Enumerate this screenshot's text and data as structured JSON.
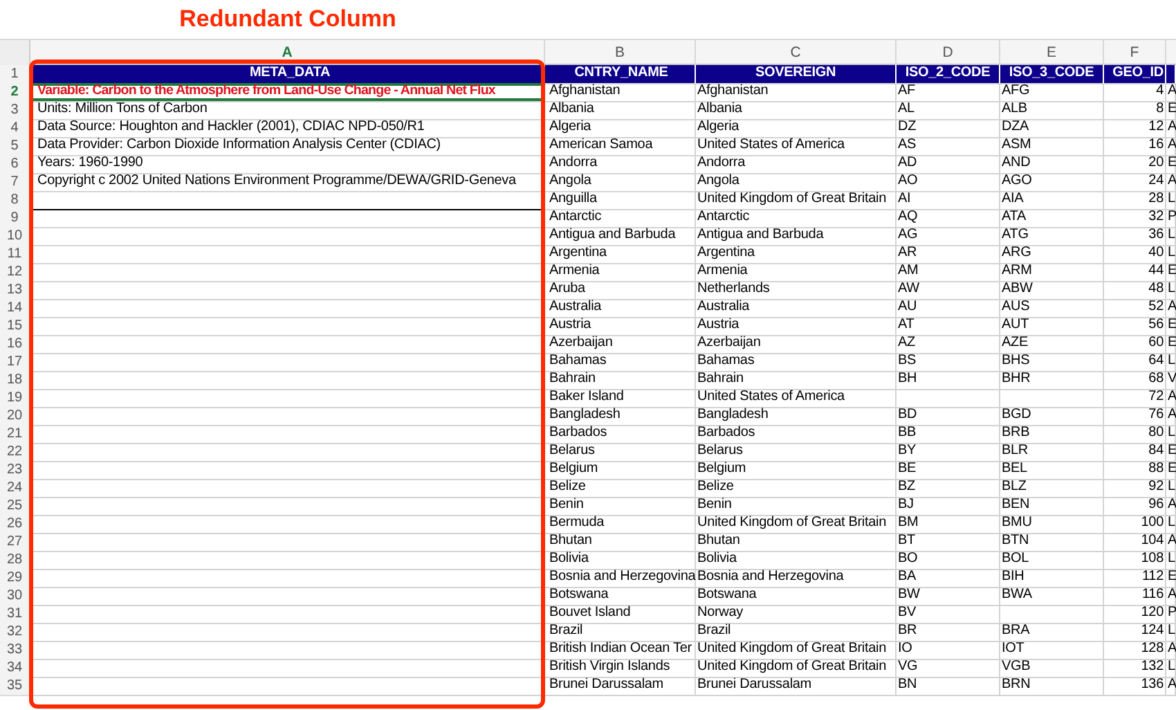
{
  "annotation": {
    "title": "Redundant Column"
  },
  "columns": [
    {
      "letter": "A",
      "selected": true
    },
    {
      "letter": "B",
      "selected": false
    },
    {
      "letter": "C",
      "selected": false
    },
    {
      "letter": "D",
      "selected": false
    },
    {
      "letter": "E",
      "selected": false
    },
    {
      "letter": "F",
      "selected": false
    }
  ],
  "rows": [
    {
      "number": "1",
      "kind": "header",
      "selected": false,
      "A": "META_DATA",
      "B": "CNTRY_NAME",
      "C": "SOVEREIGN",
      "D": "ISO_2_CODE",
      "E": "ISO_3_CODE",
      "F": "GEO_ID"
    },
    {
      "number": "2",
      "kind": "highlight",
      "selected": true,
      "A": "Variable: Carbon to the Atmosphere from Land-Use Change - Annual Net Flux",
      "B": "Afghanistan",
      "C": "Afghanistan",
      "D": "AF",
      "E": "AFG",
      "F": "4",
      "column_7": "A"
    },
    {
      "number": "3",
      "kind": "data",
      "selected": false,
      "A": "Units: Million Tons of Carbon",
      "B": "Albania",
      "C": "Albania",
      "D": "AL",
      "E": "ALB",
      "F": "8",
      "column_7": "E"
    },
    {
      "number": "4",
      "kind": "data",
      "selected": false,
      "A": "Data Source: Houghton and Hackler (2001), CDIAC NPD-050/R1",
      "B": "Algeria",
      "C": "Algeria",
      "D": "DZ",
      "E": "DZA",
      "F": "12",
      "column_7": "A"
    },
    {
      "number": "5",
      "kind": "data",
      "selected": false,
      "A": "Data Provider: Carbon Dioxide Information Analysis Center (CDIAC)",
      "B": "American Samoa",
      "C": "United States of America",
      "D": "AS",
      "E": "ASM",
      "F": "16",
      "column_7": "A"
    },
    {
      "number": "6",
      "kind": "data",
      "selected": false,
      "A": "Years: 1960-1990",
      "B": "Andorra",
      "C": "Andorra",
      "D": "AD",
      "E": "AND",
      "F": "20",
      "column_7": "E"
    },
    {
      "number": "7",
      "kind": "data",
      "selected": false,
      "A": "Copyright c 2002 United Nations Environment Programme/DEWA/GRID-Geneva",
      "B": "Angola",
      "C": "Angola",
      "D": "AO",
      "E": "AGO",
      "F": "24",
      "column_7": "A"
    },
    {
      "number": "8",
      "kind": "divider",
      "selected": false,
      "B": "Anguilla",
      "C": "United Kingdom of Great Britain",
      "D": "AI",
      "E": "AIA",
      "F": "28",
      "column_7": "L"
    },
    {
      "number": "9",
      "kind": "data",
      "selected": false,
      "B": "Antarctic",
      "C": "Antarctic",
      "D": "AQ",
      "E": "ATA",
      "F": "32",
      "column_7": "P"
    },
    {
      "number": "10",
      "kind": "data",
      "selected": false,
      "B": "Antigua and Barbuda",
      "C": "Antigua and Barbuda",
      "D": "AG",
      "E": "ATG",
      "F": "36",
      "column_7": "L"
    },
    {
      "number": "11",
      "kind": "data",
      "selected": false,
      "B": "Argentina",
      "C": "Argentina",
      "D": "AR",
      "E": "ARG",
      "F": "40",
      "column_7": "L"
    },
    {
      "number": "12",
      "kind": "data",
      "selected": false,
      "B": "Armenia",
      "C": "Armenia",
      "D": "AM",
      "E": "ARM",
      "F": "44",
      "column_7": "E"
    },
    {
      "number": "13",
      "kind": "data",
      "selected": false,
      "B": "Aruba",
      "C": "Netherlands",
      "D": "AW",
      "E": "ABW",
      "F": "48",
      "column_7": "L"
    },
    {
      "number": "14",
      "kind": "data",
      "selected": false,
      "B": "Australia",
      "C": "Australia",
      "D": "AU",
      "E": "AUS",
      "F": "52",
      "column_7": "A"
    },
    {
      "number": "15",
      "kind": "data",
      "selected": false,
      "B": "Austria",
      "C": "Austria",
      "D": "AT",
      "E": "AUT",
      "F": "56",
      "column_7": "E"
    },
    {
      "number": "16",
      "kind": "data",
      "selected": false,
      "B": "Azerbaijan",
      "C": "Azerbaijan",
      "D": "AZ",
      "E": "AZE",
      "F": "60",
      "column_7": "E"
    },
    {
      "number": "17",
      "kind": "data",
      "selected": false,
      "B": "Bahamas",
      "C": "Bahamas",
      "D": "BS",
      "E": "BHS",
      "F": "64",
      "column_7": "L"
    },
    {
      "number": "18",
      "kind": "data",
      "selected": false,
      "B": "Bahrain",
      "C": "Bahrain",
      "D": "BH",
      "E": "BHR",
      "F": "68",
      "column_7": "V"
    },
    {
      "number": "19",
      "kind": "data",
      "selected": false,
      "B": "Baker Island",
      "C": "United States of America",
      "F": "72",
      "column_7": "A"
    },
    {
      "number": "20",
      "kind": "data",
      "selected": false,
      "B": "Bangladesh",
      "C": "Bangladesh",
      "D": "BD",
      "E": "BGD",
      "F": "76",
      "column_7": "A"
    },
    {
      "number": "21",
      "kind": "data",
      "selected": false,
      "B": "Barbados",
      "C": "Barbados",
      "D": "BB",
      "E": "BRB",
      "F": "80",
      "column_7": "L"
    },
    {
      "number": "22",
      "kind": "data",
      "selected": false,
      "B": "Belarus",
      "C": "Belarus",
      "D": "BY",
      "E": "BLR",
      "F": "84",
      "column_7": "E"
    },
    {
      "number": "23",
      "kind": "data",
      "selected": false,
      "B": "Belgium",
      "C": "Belgium",
      "D": "BE",
      "E": "BEL",
      "F": "88",
      "column_7": "E"
    },
    {
      "number": "24",
      "kind": "data",
      "selected": false,
      "B": "Belize",
      "C": "Belize",
      "D": "BZ",
      "E": "BLZ",
      "F": "92",
      "column_7": "L"
    },
    {
      "number": "25",
      "kind": "data",
      "selected": false,
      "B": "Benin",
      "C": "Benin",
      "D": "BJ",
      "E": "BEN",
      "F": "96",
      "column_7": "A"
    },
    {
      "number": "26",
      "kind": "data",
      "selected": false,
      "B": "Bermuda",
      "C": "United Kingdom of Great Britain",
      "D": "BM",
      "E": "BMU",
      "F": "100",
      "column_7": "L"
    },
    {
      "number": "27",
      "kind": "data",
      "selected": false,
      "B": "Bhutan",
      "C": "Bhutan",
      "D": "BT",
      "E": "BTN",
      "F": "104",
      "column_7": "A"
    },
    {
      "number": "28",
      "kind": "data",
      "selected": false,
      "B": "Bolivia",
      "C": "Bolivia",
      "D": "BO",
      "E": "BOL",
      "F": "108",
      "column_7": "L"
    },
    {
      "number": "29",
      "kind": "data",
      "selected": false,
      "B": "Bosnia and Herzegovina",
      "C": "Bosnia and Herzegovina",
      "D": "BA",
      "E": "BIH",
      "F": "112",
      "column_7": "E"
    },
    {
      "number": "30",
      "kind": "data",
      "selected": false,
      "B": "Botswana",
      "C": "Botswana",
      "D": "BW",
      "E": "BWA",
      "F": "116",
      "column_7": "A"
    },
    {
      "number": "31",
      "kind": "data",
      "selected": false,
      "B": "Bouvet Island",
      "C": "Norway",
      "D": "BV",
      "F": "120",
      "column_7": "P"
    },
    {
      "number": "32",
      "kind": "data",
      "selected": false,
      "B": "Brazil",
      "C": "Brazil",
      "D": "BR",
      "E": "BRA",
      "F": "124",
      "column_7": "L"
    },
    {
      "number": "33",
      "kind": "data",
      "selected": false,
      "B": "British Indian Ocean Ter",
      "C": "United Kingdom of Great Britain",
      "D": "IO",
      "E": "IOT",
      "F": "128",
      "column_7": "A"
    },
    {
      "number": "34",
      "kind": "data",
      "selected": false,
      "B": "British Virgin Islands",
      "C": "United Kingdom of Great Britain",
      "D": "VG",
      "E": "VGB",
      "F": "132",
      "column_7": "L"
    },
    {
      "number": "35",
      "kind": "data",
      "selected": false,
      "B": "Brunei Darussalam",
      "C": "Brunei Darussalam",
      "D": "BN",
      "E": "BRN",
      "F": "136",
      "column_7": "A"
    }
  ]
}
